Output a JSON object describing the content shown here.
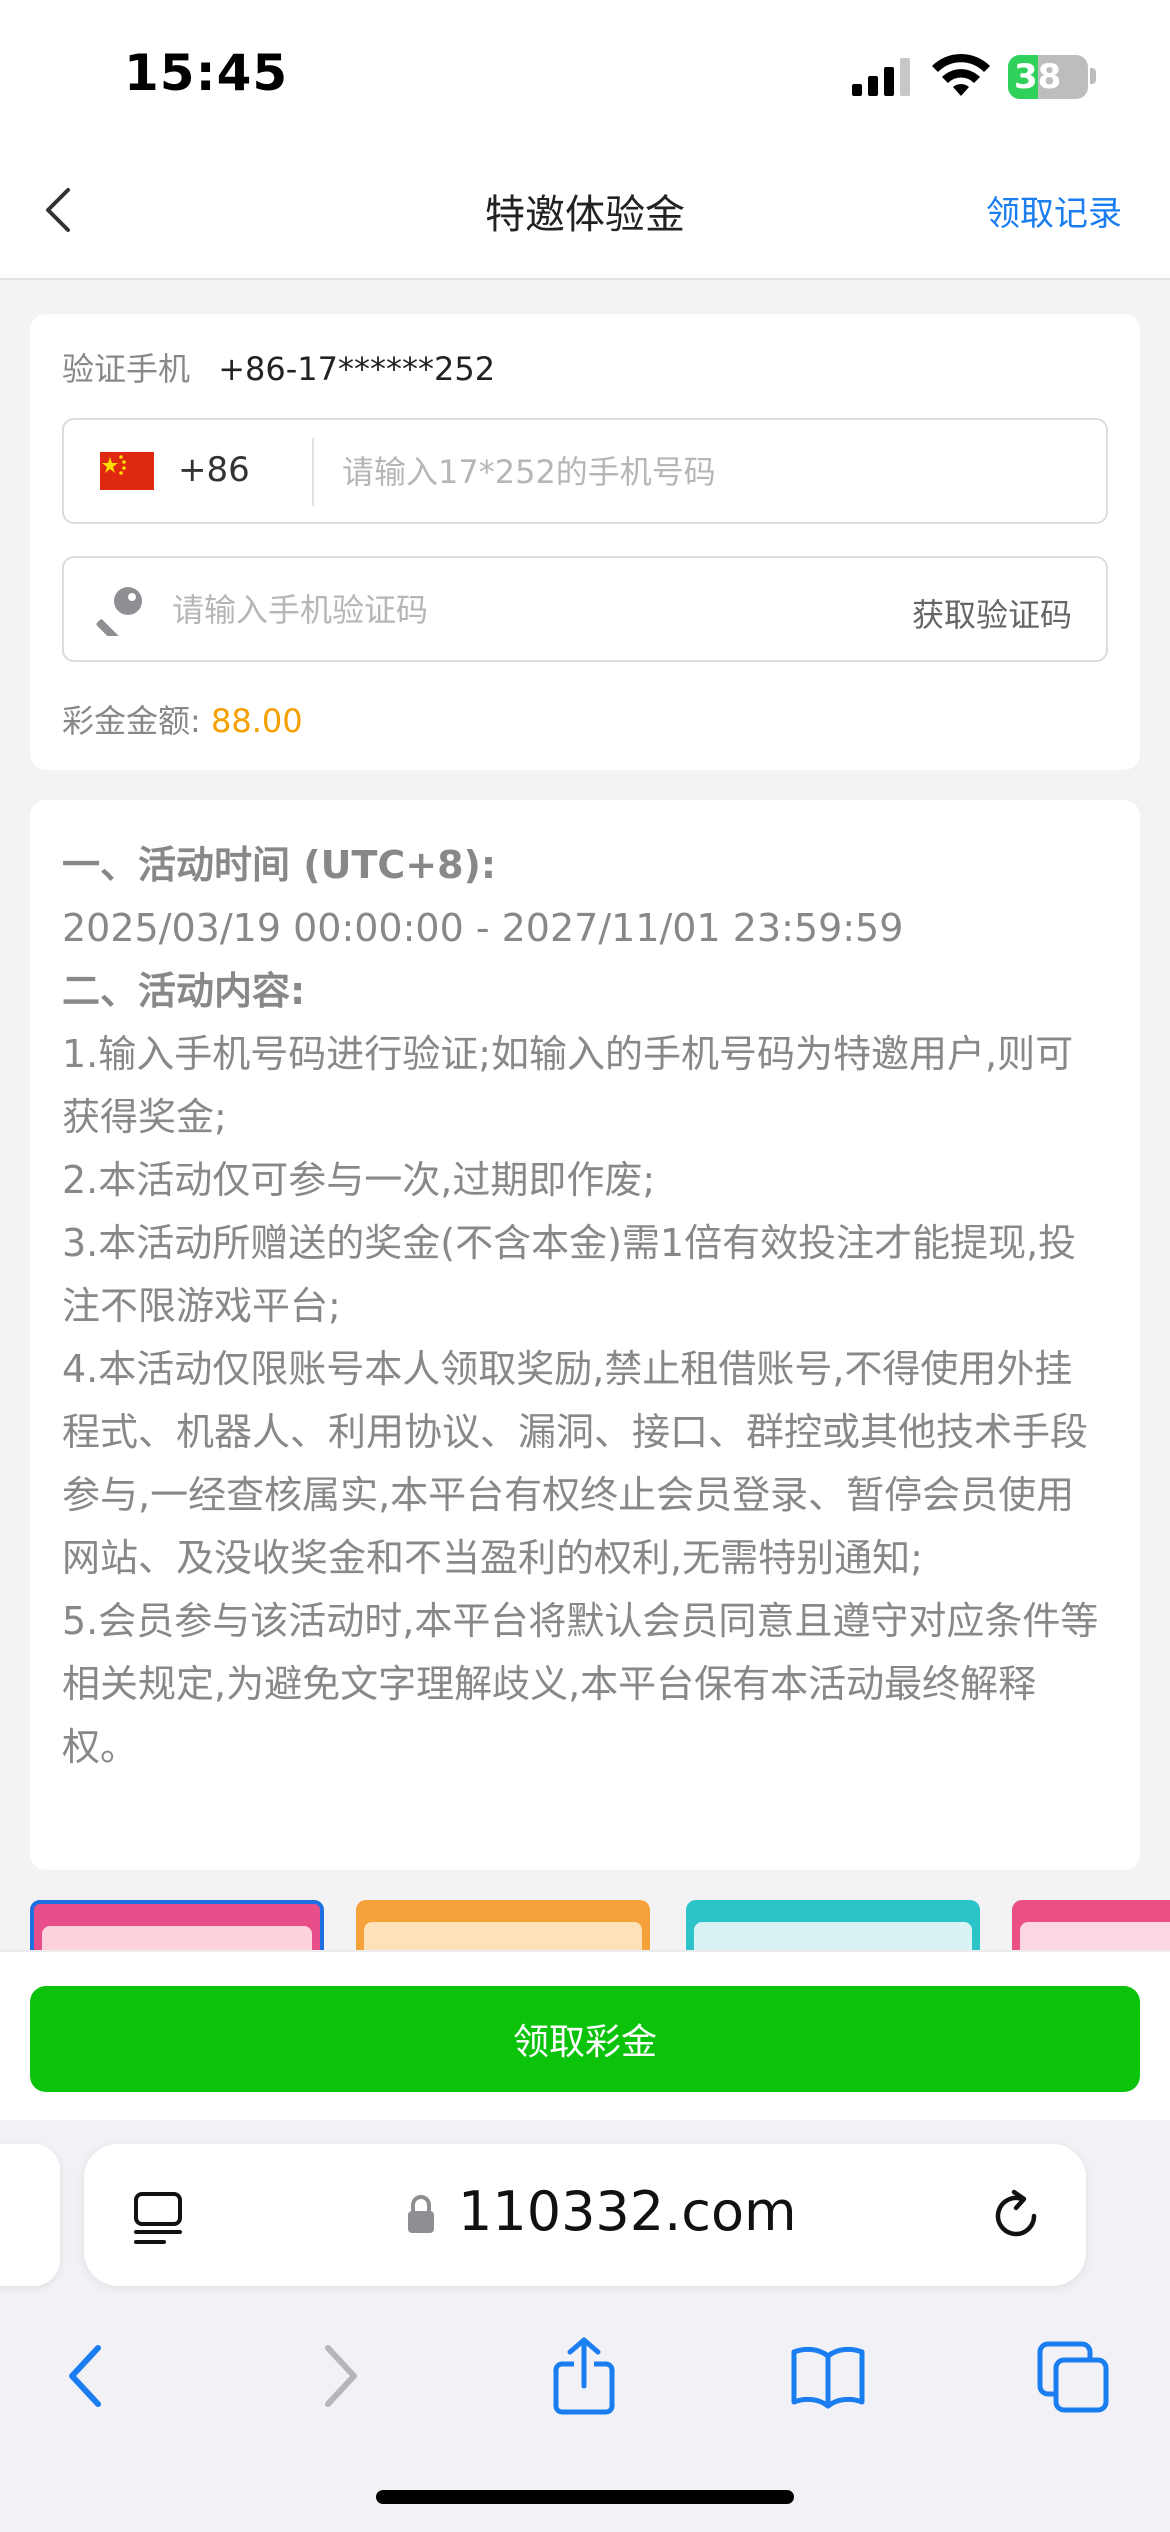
{
  "status_bar": {
    "time": "15:45",
    "battery": "38"
  },
  "navbar": {
    "title": "特邀体验金",
    "action": "领取记录"
  },
  "form": {
    "verify_label": "验证手机",
    "verify_value": "+86-17******252",
    "country_code": "+86",
    "phone_placeholder": "请输入17*252的手机号码",
    "code_placeholder": "请输入手机验证码",
    "get_code": "获取验证码",
    "amount_label": "彩金金额:",
    "amount_value": "88.00"
  },
  "rules": [
    {
      "text": "一、活动时间 (UTC+8):",
      "heading": true
    },
    {
      "text": "2025/03/19 00:00:00 - 2027/11/01 23:59:59",
      "heading": false
    },
    {
      "text": "二、活动内容:",
      "heading": true
    },
    {
      "text": "1.输入手机号码进行验证;如输入的手机号码为特邀用户,则可获得奖金;",
      "heading": false
    },
    {
      "text": "2.本活动仅可参与一次,过期即作废;",
      "heading": false
    },
    {
      "text": "3.本活动所赠送的奖金(不含本金)需1倍有效投注才能提现,投注不限游戏平台;",
      "heading": false
    },
    {
      "text": "4.本活动仅限账号本人领取奖励,禁止租借账号,不得使用外挂程式、机器人、利用协议、漏洞、接口、群控或其他技术手段参与,一经查核属实,本平台有权终止会员登录、暂停会员使用网站、及没收奖金和不当盈利的权利,无需特别通知;",
      "heading": false
    },
    {
      "text": "5.会员参与该活动时,本平台将默认会员同意且遵守对应条件等相关规定,为避免文字理解歧义,本平台保有本活动最终解释权。",
      "heading": false
    }
  ],
  "claim_button": "领取彩金",
  "browser": {
    "url": "110332.com"
  },
  "colors": {
    "accent": "#1a7df0",
    "amount": "#f5a000",
    "claim": "#0bc30b"
  }
}
